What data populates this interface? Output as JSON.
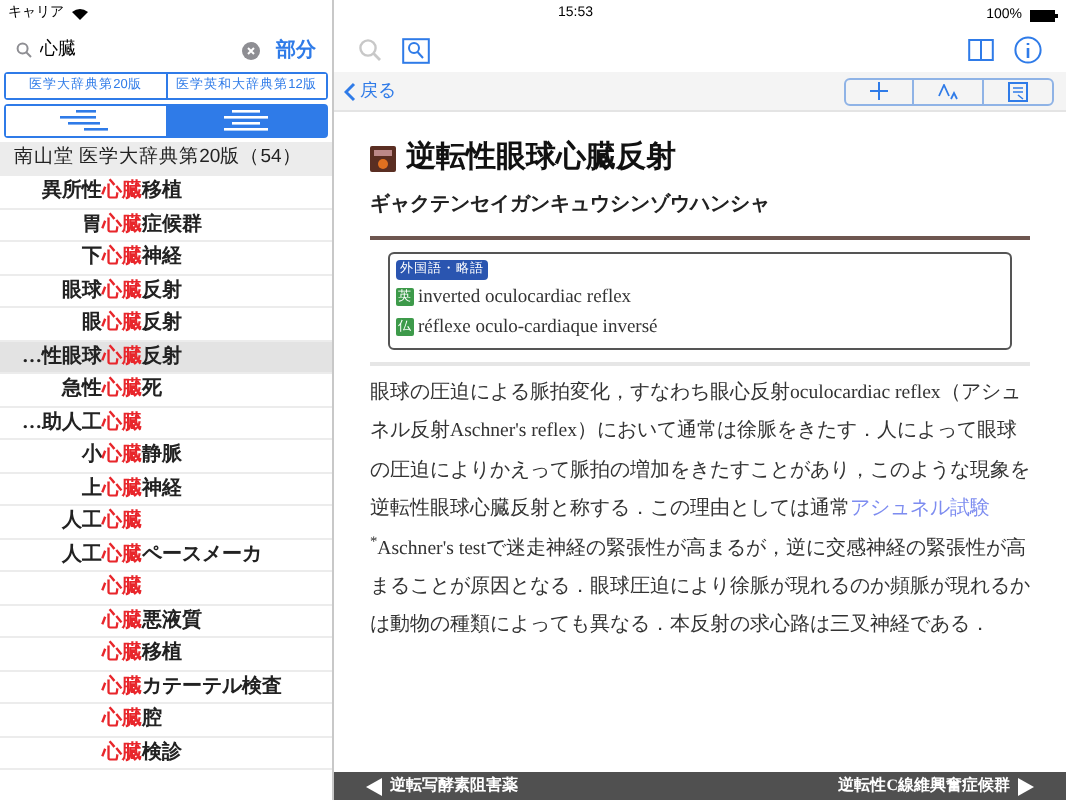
{
  "status_bar": {
    "carrier": "キャリア",
    "time": "15:53",
    "battery": "100%"
  },
  "search": {
    "value": "心臓",
    "mode_button": "部分"
  },
  "dictionary_tabs": [
    {
      "label": "医学大辞典第20版",
      "selected": false
    },
    {
      "label": "医学英和大辞典第12版",
      "selected": false
    }
  ],
  "view_tabs": [
    {
      "kind": "indented",
      "selected": false
    },
    {
      "kind": "aligned",
      "selected": true
    }
  ],
  "results_header": "南山堂 医学大辞典第20版（54）",
  "results": [
    {
      "prefix": "異所性",
      "match": "心臓",
      "suffix": "移植",
      "selected": false
    },
    {
      "prefix": "胃",
      "match": "心臓",
      "suffix": "症候群",
      "selected": false
    },
    {
      "prefix": "下",
      "match": "心臓",
      "suffix": "神経",
      "selected": false
    },
    {
      "prefix": "眼球",
      "match": "心臓",
      "suffix": "反射",
      "selected": false
    },
    {
      "prefix": "眼",
      "match": "心臓",
      "suffix": "反射",
      "selected": false
    },
    {
      "prefix": "…性眼球",
      "match": "心臓",
      "suffix": "反射",
      "selected": true
    },
    {
      "prefix": "急性",
      "match": "心臓",
      "suffix": "死",
      "selected": false
    },
    {
      "prefix": "…助人工",
      "match": "心臓",
      "selected": false
    },
    {
      "prefix": "小",
      "match": "心臓",
      "suffix": "静脈",
      "selected": false
    },
    {
      "prefix": "上",
      "match": "心臓",
      "suffix": "神経",
      "selected": false
    },
    {
      "prefix": "人工",
      "match": "心臓",
      "selected": false
    },
    {
      "prefix": "人工",
      "match": "心臓",
      "suffix": "ペースメーカ",
      "selected": false
    },
    {
      "match": "心臓",
      "selected": false
    },
    {
      "match": "心臓",
      "suffix": "悪液質",
      "selected": false
    },
    {
      "match": "心臓",
      "suffix": "移植",
      "selected": false
    },
    {
      "match": "心臓",
      "suffix": "カテーテル検査",
      "selected": false
    },
    {
      "match": "心臓",
      "suffix": "腔",
      "selected": false
    },
    {
      "match": "心臓",
      "suffix": "検診",
      "selected": false
    }
  ],
  "back_button": "戻る",
  "entry": {
    "title": "逆転性眼球心臓反射",
    "reading": "ギャクテンセイガンキュウシンゾウハンシャ",
    "foreign_box": {
      "badge": "外国語・略語",
      "terms": [
        {
          "lang": "英",
          "term": "inverted oculocardiac reflex"
        },
        {
          "lang": "仏",
          "term": "réflexe oculo-cardiaque inversé"
        }
      ]
    },
    "body_before": "眼球の圧迫による脈拍変化，すなわち眼心反射oculocardiac reflex（アシュネル反射Aschner's reflex）において通常は徐脈をきたす．人によって眼球の圧迫によりかえって脈拍の増加をきたすことがあり，このような現象を逆転性眼球心臓反射と称する．この理由としては通常",
    "body_link": "アシュネル試験",
    "body_after": "$^{*}$Aschner's testで迷走神経の緊張性が高まるが，逆に交感神経の緊張性が高まることが原因となる．眼球圧迫により徐脈が現れるのか頻脈が現れるかは動物の種類によっても異なる．本反射の求心路は三叉神経である．"
  },
  "prev_entry": "逆転写酵素阻害薬",
  "next_entry": "逆転性C線維興奮症候群"
}
